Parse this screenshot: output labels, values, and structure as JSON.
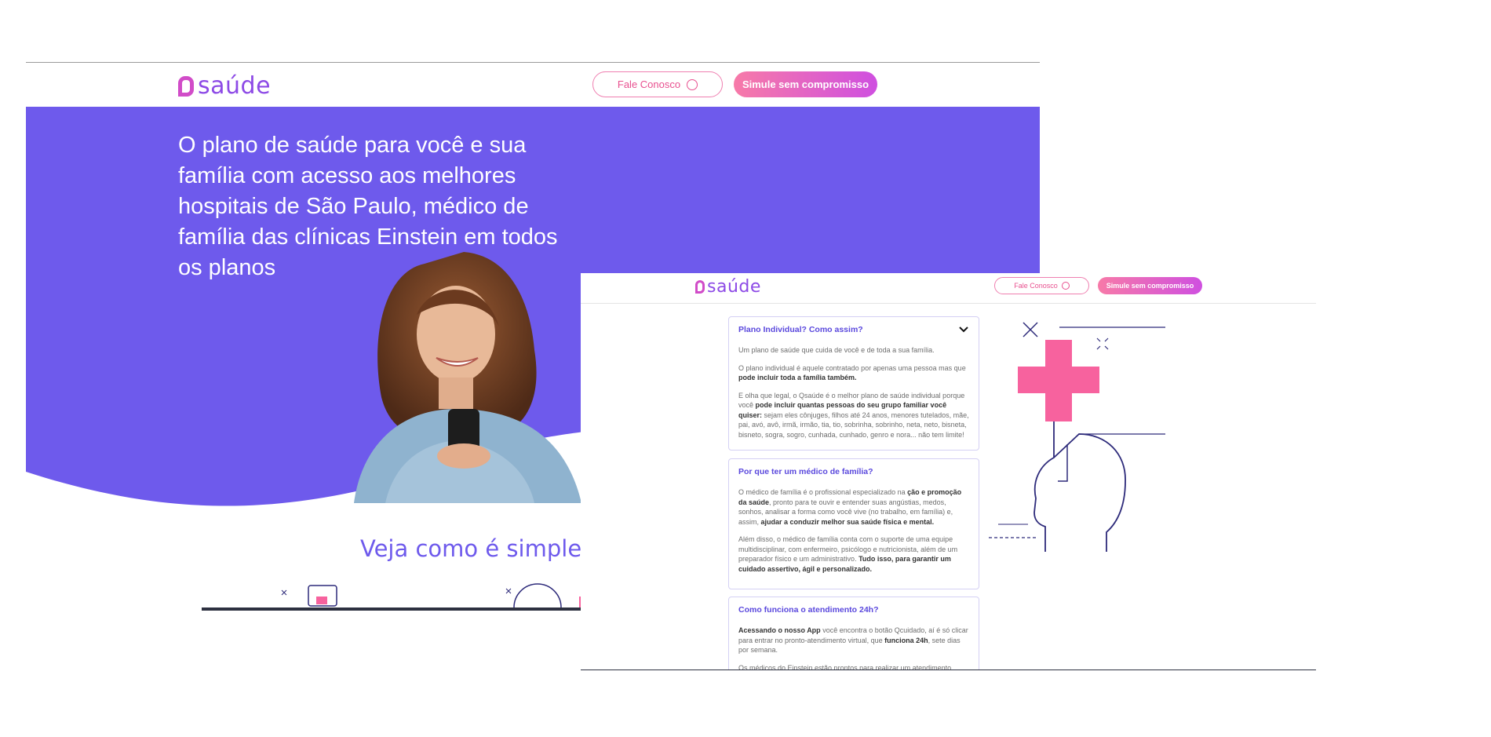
{
  "shot1": {
    "logo": {
      "text": "saúde"
    },
    "header": {
      "contact_label": "Fale Conosco",
      "simulate_label": "Simule sem compromisso"
    },
    "hero": {
      "headline": "O plano de saúde para você e sua família com acesso aos melhores hospitais de São Paulo, médico de família das clínicas Einstein em todos os planos"
    },
    "section_title": "Veja como é simples s"
  },
  "shot2": {
    "logo": {
      "text": "saúde"
    },
    "header": {
      "contact_label": "Fale Conosco",
      "simulate_label": "Simule sem compromisso"
    },
    "faq": [
      {
        "question": "Plano Individual? Como assim?",
        "p1": "Um plano de saúde que cuida de você e de toda a sua família.",
        "p2_a": "O plano individual é aquele contratado por apenas uma pessoa mas que ",
        "p2_b": "pode incluir toda a família também.",
        "p3_a": "E olha que legal, o Qsaúde é o melhor plano de saúde individual porque você ",
        "p3_b": "pode incluir quantas pessoas do seu grupo familiar você quiser:",
        "p3_c": " sejam eles cônjuges, filhos até 24 anos, menores tutelados, mãe, pai, avó, avô, irmã, irmão, tia, tio, sobrinha, sobrinho, neta, neto, bisneta, bisneto, sogra, sogro, cunhada, cunhado, genro e nora... não tem limite!"
      },
      {
        "question": "Por que ter um médico de família?",
        "p1_a": "O médico de família é o profissional especializado na ",
        "p1_b": "ção e promoção da saúde",
        "p1_c": ", pronto para te ouvir e entender suas angústias, medos, sonhos, analisar a forma como você vive (no trabalho, em família) e, assim, ",
        "p1_d": "ajudar a conduzir melhor sua saúde física e mental.",
        "p2_a": "Além disso, o médico de família conta com o suporte de uma equipe multidisciplinar, com enfermeiro, psicólogo e nutricionista, além de um preparador físico e um administrativo. ",
        "p2_b": "Tudo isso, para garantir um cuidado assertivo, ágil e personalizado."
      },
      {
        "question": "Como funciona o atendimento 24h?",
        "p1_a": "Acessando o nosso App",
        "p1_b": " você encontra o botão Qcuidado, aí é só clicar para entrar no pronto-atendimento virtual, que ",
        "p1_c": "funciona 24h",
        "p1_d": ", sete dias por semana.",
        "p2": "Os médicos do Einstein estão prontos para realizar um atendimento"
      }
    ]
  },
  "icons": {
    "whatsapp": "whatsapp-icon",
    "chevron": "chevron-down-icon",
    "cross": "medical-cross-icon"
  },
  "colors": {
    "brand_purple": "#6e5aec",
    "pink": "#f7629e",
    "gradient_start": "#f77aa8",
    "gradient_end": "#cf4fe0",
    "illustration_line": "#2d2a7a"
  }
}
